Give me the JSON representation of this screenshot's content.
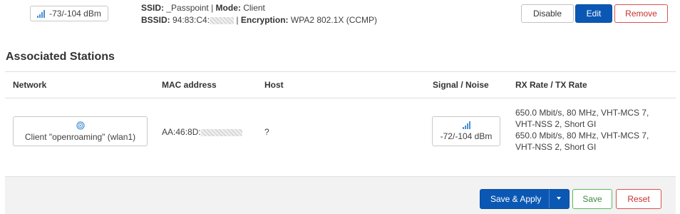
{
  "wifi": {
    "signal_value": "-73/-104 dBm",
    "ssid_label": "SSID:",
    "ssid_value": "_Passpoint",
    "mode_label": "Mode:",
    "mode_value": "Client",
    "bssid_label": "BSSID:",
    "bssid_value": "94:83:C4:",
    "encryption_label": "Encryption:",
    "encryption_value": "WPA2 802.1X (CCMP)",
    "buttons": {
      "disable": "Disable",
      "edit": "Edit",
      "remove": "Remove"
    }
  },
  "stations": {
    "title": "Associated Stations",
    "columns": [
      "Network",
      "MAC address",
      "Host",
      "Signal / Noise",
      "RX Rate / TX Rate"
    ],
    "rows": [
      {
        "network": "Client \"openroaming\" (wlan1)",
        "mac": "AA:46:8D:",
        "host": "?",
        "signal": "-72/-104 dBm",
        "rx_rate_line1": "650.0 Mbit/s, 80 MHz, VHT-MCS 7,",
        "rx_rate_line2": "VHT-NSS 2, Short GI",
        "tx_rate_line1": "650.0 Mbit/s, 80 MHz, VHT-MCS 7,",
        "tx_rate_line2": "VHT-NSS 2, Short GI"
      }
    ]
  },
  "footer": {
    "save_apply": "Save & Apply",
    "save": "Save",
    "reset": "Reset"
  },
  "colors": {
    "primary": "#0b58b4",
    "success": "#5cb85c",
    "danger": "#d9534f",
    "signal_bars": "#4a8fd6"
  }
}
